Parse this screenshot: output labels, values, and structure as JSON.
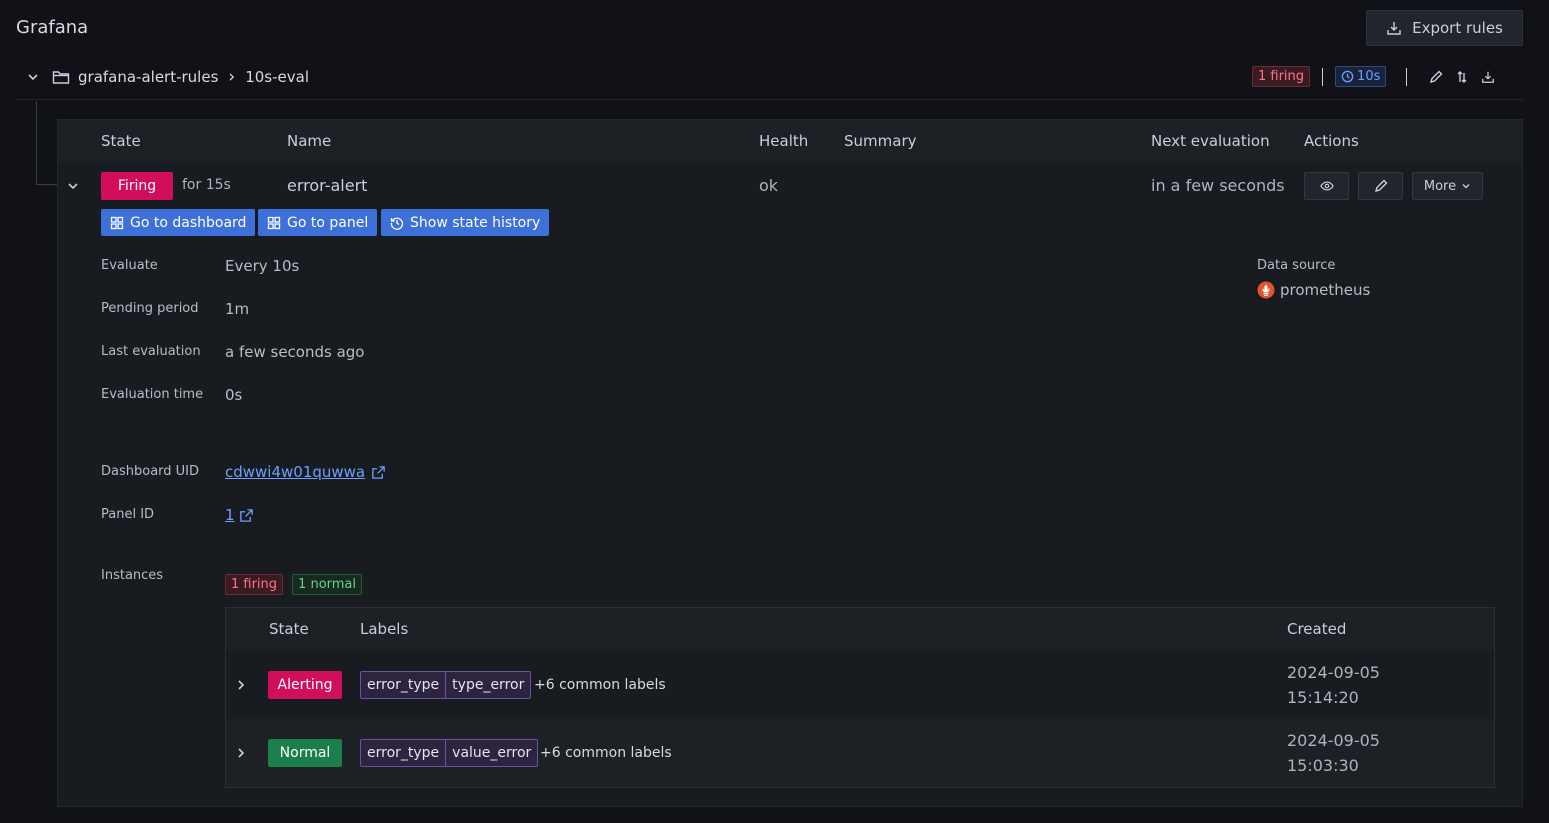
{
  "app": {
    "title": "Grafana"
  },
  "header": {
    "export_label": "Export rules"
  },
  "group": {
    "folder": "grafana-alert-rules",
    "separator": "›",
    "name": "10s-eval",
    "firing_tag": "1 firing",
    "interval_tag": "10s"
  },
  "table": {
    "headers": {
      "state": "State",
      "name": "Name",
      "health": "Health",
      "summary": "Summary",
      "next": "Next evaluation",
      "actions": "Actions"
    },
    "rule": {
      "state": "Firing",
      "for": "for 15s",
      "name": "error-alert",
      "health": "ok",
      "next": "in a few seconds",
      "more_label": "More"
    }
  },
  "buttons": {
    "dashboard": "Go to dashboard",
    "panel": "Go to panel",
    "history": "Show state history"
  },
  "details": {
    "evaluate_label": "Evaluate",
    "evaluate_value": "Every 10s",
    "pending_label": "Pending period",
    "pending_value": "1m",
    "last_label": "Last evaluation",
    "last_value": "a few seconds ago",
    "evaltime_label": "Evaluation time",
    "evaltime_value": "0s",
    "dashuid_label": "Dashboard UID",
    "dashuid_value": "cdwwi4w01quwwa",
    "panelid_label": "Panel ID",
    "panelid_value": "1",
    "datasource_label": "Data source",
    "datasource_value": "prometheus"
  },
  "instances": {
    "label": "Instances",
    "firing_tag": "1 firing",
    "normal_tag": "1 normal",
    "headers": {
      "state": "State",
      "labels": "Labels",
      "created": "Created"
    },
    "rows": [
      {
        "state": "Alerting",
        "label_key": "error_type",
        "label_value": "type_error",
        "common": "+6 common labels",
        "created_date": "2024-09-05",
        "created_time": "15:14:20"
      },
      {
        "state": "Normal",
        "label_key": "error_type",
        "label_value": "value_error",
        "common": "+6 common labels",
        "created_date": "2024-09-05",
        "created_time": "15:03:30"
      }
    ]
  },
  "colors": {
    "firing": "#d10e5c",
    "normal": "#1a7f4b",
    "link": "#6e9fff",
    "primary_button": "#3d71d9",
    "label_chip": "#6b4fa8"
  }
}
